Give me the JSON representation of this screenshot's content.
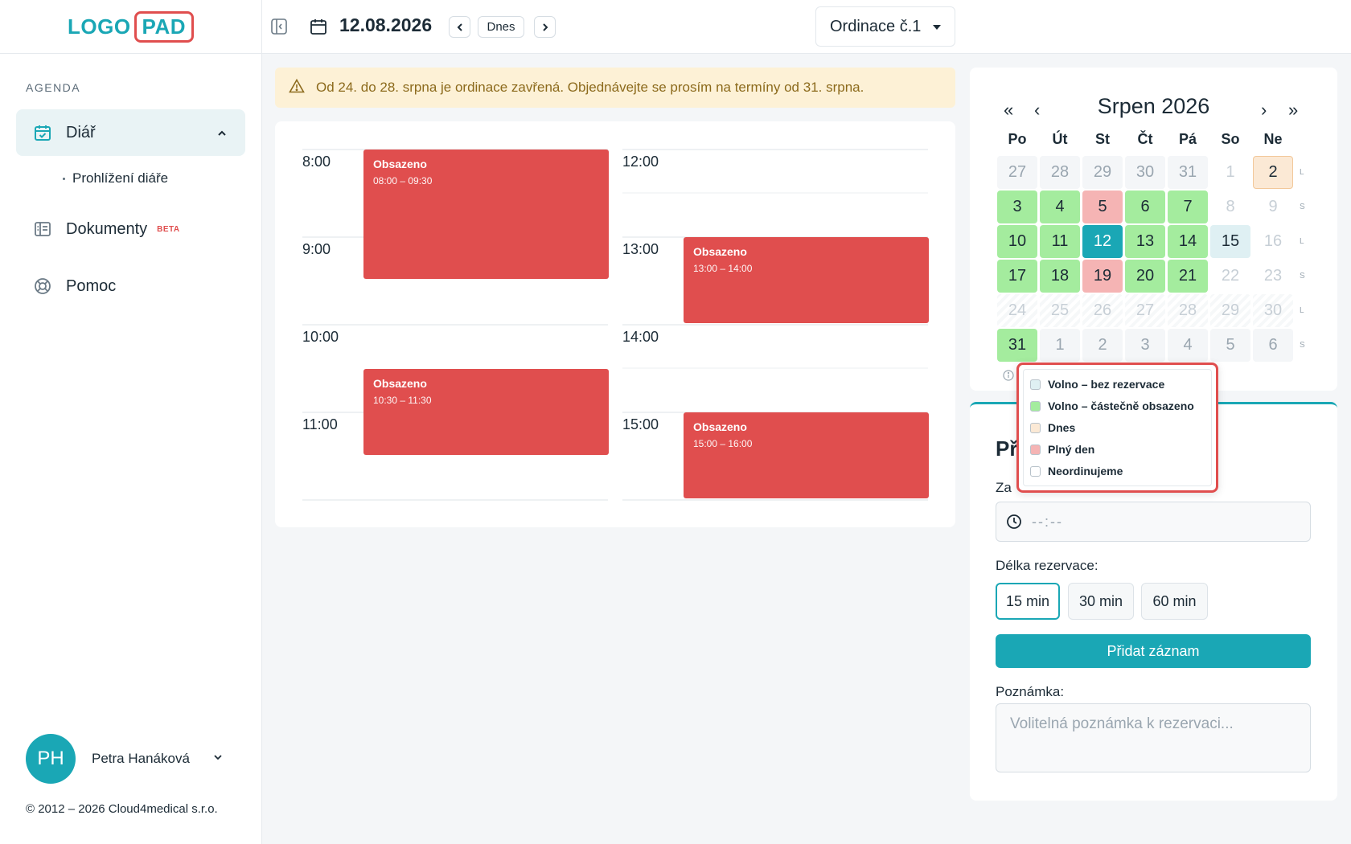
{
  "sidebar": {
    "logo_left": "LOGO",
    "logo_right": "PAD",
    "section_label": "AGENDA",
    "items": [
      {
        "label": "Diář",
        "icon": "calendar-check-icon"
      },
      {
        "label": "Dokumenty",
        "badge": "BETA",
        "icon": "document-icon"
      },
      {
        "label": "Pomoc",
        "icon": "lifebuoy-icon"
      }
    ],
    "subitem": "Prohlížení diáře",
    "user": {
      "initials": "PH",
      "name": "Petra Hanáková"
    },
    "copyright": "© 2012 – 2026 Cloud4medical s.r.o."
  },
  "topbar": {
    "date": "12.08.2026",
    "today_label": "Dnes",
    "room": "Ordinace č.1"
  },
  "alert": {
    "text": "Od 24. do 28. srpna je ordinace zavřená. Objednávejte se prosím na termíny od 31. srpna."
  },
  "schedule": {
    "left_hours": [
      "8:00",
      "9:00",
      "10:00",
      "11:00"
    ],
    "right_hours": [
      "12:00",
      "13:00",
      "14:00",
      "15:00"
    ],
    "events": [
      {
        "title": "Obsazeno",
        "time": "08:00 – 09:30"
      },
      {
        "title": "Obsazeno",
        "time": "10:30 – 11:30"
      },
      {
        "title": "Obsazeno",
        "time": "13:00 – 14:00"
      },
      {
        "title": "Obsazeno",
        "time": "15:00 – 16:00"
      }
    ]
  },
  "calendar": {
    "title": "Srpen 2026",
    "nav": {
      "prev_year": "«",
      "prev_month": "‹",
      "next_month": "›",
      "next_year": "»"
    },
    "weekdays": [
      "Po",
      "Út",
      "St",
      "Čt",
      "Pá",
      "So",
      "Ne"
    ],
    "week_tags": [
      "L",
      "S",
      "L",
      "S",
      "L",
      "S"
    ],
    "weeks": [
      [
        "27",
        "28",
        "29",
        "30",
        "31",
        "1",
        "2"
      ],
      [
        "3",
        "4",
        "5",
        "6",
        "7",
        "8",
        "9"
      ],
      [
        "10",
        "11",
        "12",
        "13",
        "14",
        "15",
        "16"
      ],
      [
        "17",
        "18",
        "19",
        "20",
        "21",
        "22",
        "23"
      ],
      [
        "24",
        "25",
        "26",
        "27",
        "28",
        "29",
        "30"
      ],
      [
        "31",
        "1",
        "2",
        "3",
        "4",
        "5",
        "6"
      ]
    ]
  },
  "legend": {
    "items": [
      {
        "label": "Volno – bez rezervace",
        "color": "#dff0f3"
      },
      {
        "label": "Volno – částečně obsazeno",
        "color": "#a4ec9e"
      },
      {
        "label": "Dnes",
        "color": "#fbe9d5"
      },
      {
        "label": "Plný den",
        "color": "#f5b4b4"
      },
      {
        "label": "Neordinujeme",
        "color": "#ffffff"
      }
    ]
  },
  "form": {
    "title_partial": "Př",
    "time_label_partial": "Za",
    "time_placeholder": "--:--",
    "duration_label": "Délka rezervace:",
    "durations": [
      "15 min",
      "30 min",
      "60 min"
    ],
    "add_button": "Přidat záznam",
    "note_label": "Poznámka:",
    "note_placeholder": "Volitelná poznámka k rezervaci..."
  },
  "colors": {
    "accent": "#1aa7b5",
    "busy": "#e04e4e",
    "alert_bg": "#fdf1d6"
  }
}
